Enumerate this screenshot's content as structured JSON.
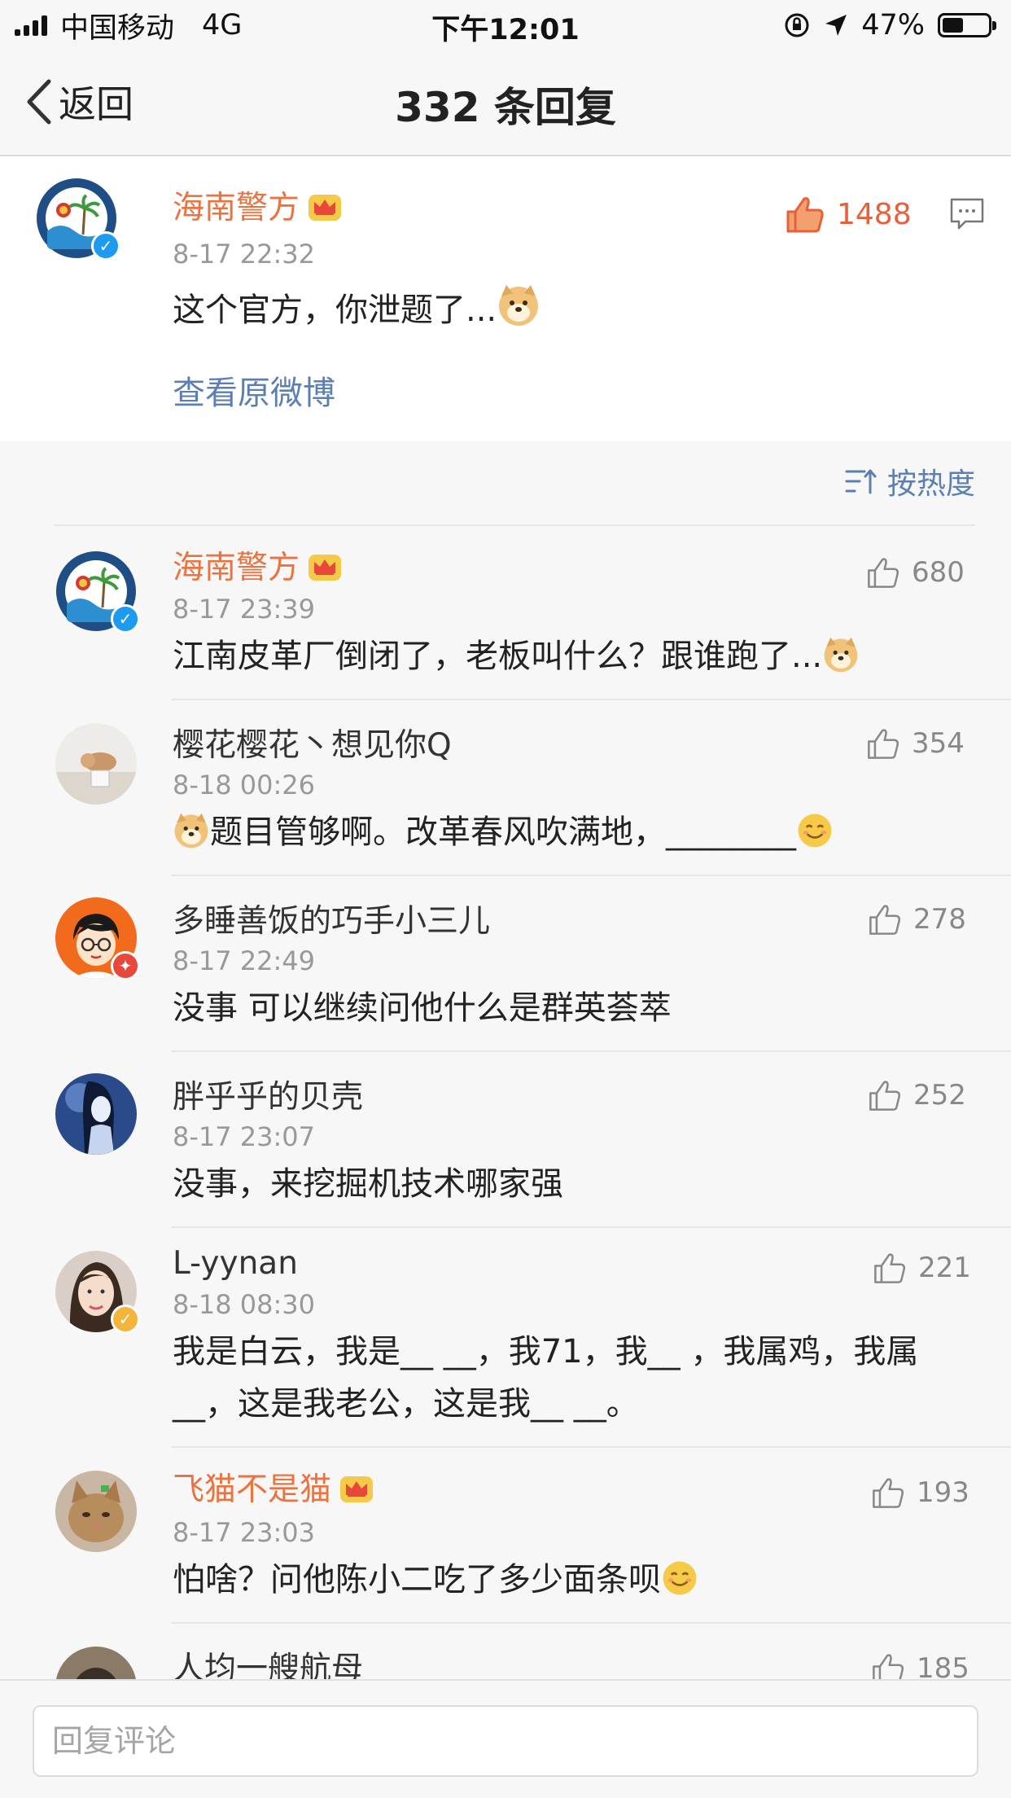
{
  "status_bar": {
    "carrier": "中国移动",
    "network": "4G",
    "time": "下午12:01",
    "battery": "47%",
    "battery_level": 0.47
  },
  "nav": {
    "back_label": "返回",
    "title": "332 条回复"
  },
  "original_comment": {
    "username": "海南警方",
    "timestamp": "8-17 22:32",
    "text": "这个官方，你泄题了...",
    "likes": "1488",
    "view_original_label": "查看原微博"
  },
  "sort": {
    "label": "按热度"
  },
  "replies": [
    {
      "username": "海南警方",
      "timestamp": "8-17 23:39",
      "text": "江南皮革厂倒闭了，老板叫什么？跟谁跑了...",
      "likes": "680"
    },
    {
      "username": "樱花樱花丶想见你Q",
      "timestamp": "8-18 00:26",
      "text": "题目管够啊。改革春风吹满地，________",
      "likes": "354"
    },
    {
      "username": "多睡善饭的巧手小三儿",
      "timestamp": "8-17 22:49",
      "text": "没事 可以继续问他什么是群英荟萃",
      "likes": "278"
    },
    {
      "username": "胖乎乎的贝壳",
      "timestamp": "8-17 23:07",
      "text": "没事，来挖掘机技术哪家强",
      "likes": "252"
    },
    {
      "username": "L-yynan",
      "timestamp": "8-18 08:30",
      "text": "我是白云，我是__ __，我71，我__ ，我属鸡，我属__，这是我老公，这是我__ __。",
      "likes": "221"
    },
    {
      "username": "飞猫不是猫",
      "timestamp": "8-17 23:03",
      "text": "怕啥？问他陈小二吃了多少面条呗",
      "likes": "193"
    },
    {
      "username": "人均一艘航母",
      "likes": "185"
    }
  ],
  "bottom": {
    "reply_placeholder": "回复评论"
  },
  "colors": {
    "accent_orange": "#eb7340",
    "link_blue": "#5b7fb3",
    "like_red": "#e8603a"
  }
}
